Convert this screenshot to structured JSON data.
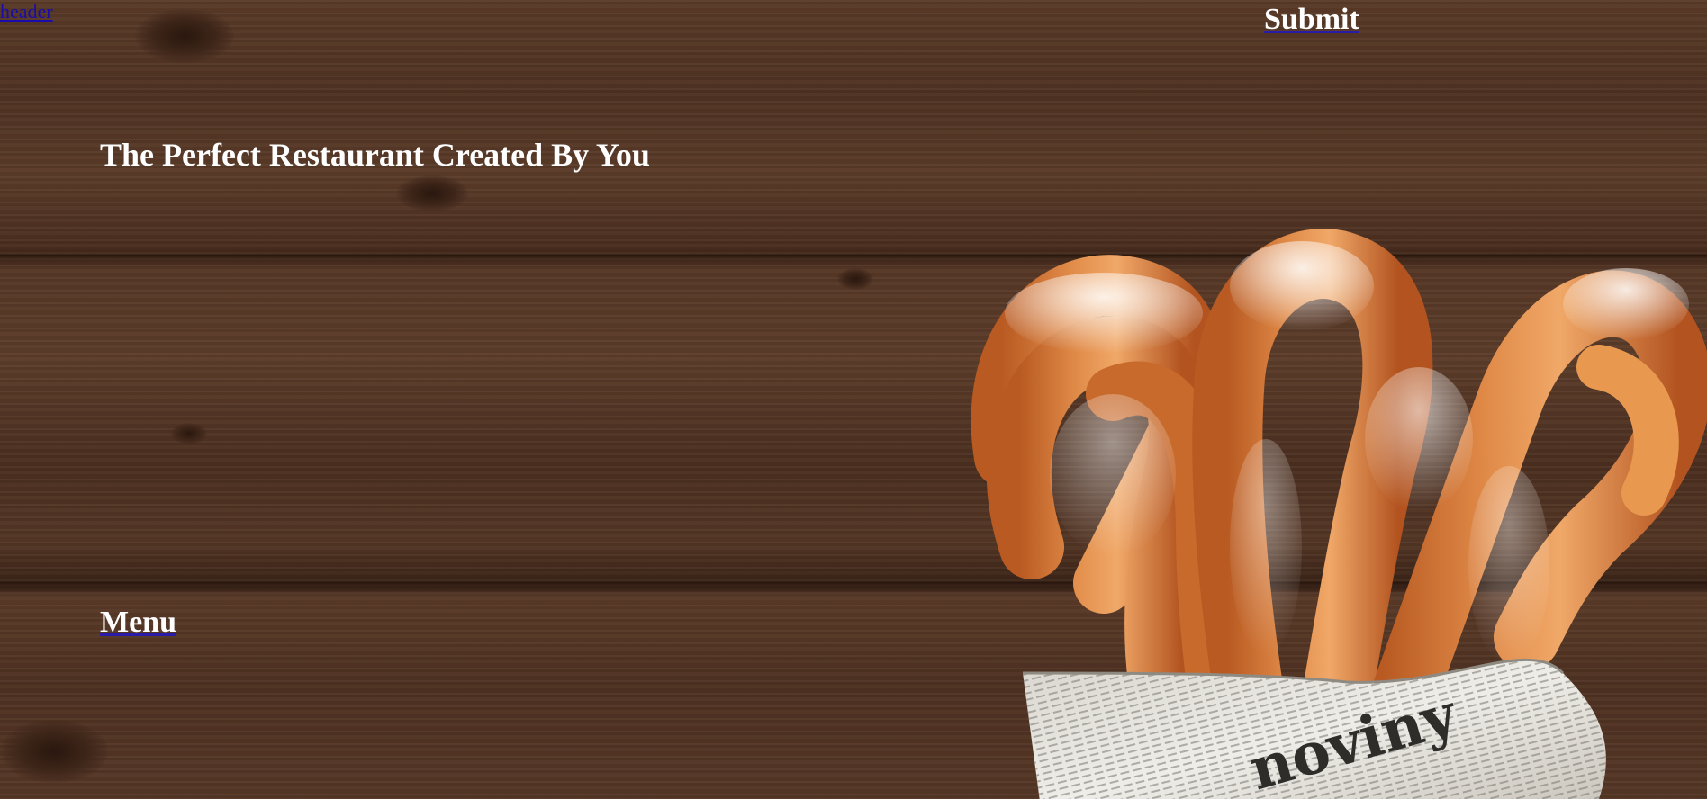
{
  "header": {
    "link_label": "header",
    "submit_label": "Submit"
  },
  "hero": {
    "title": "The Perfect Restaurant Created By You"
  },
  "nav": {
    "menu_label": "Menu"
  },
  "colors": {
    "wood": "#4a2e1f",
    "link_blue": "#1a0dab",
    "heading_text": "#ffffff"
  },
  "images": {
    "background": "wood-planks",
    "hero_picture": "churros-in-newspaper"
  }
}
